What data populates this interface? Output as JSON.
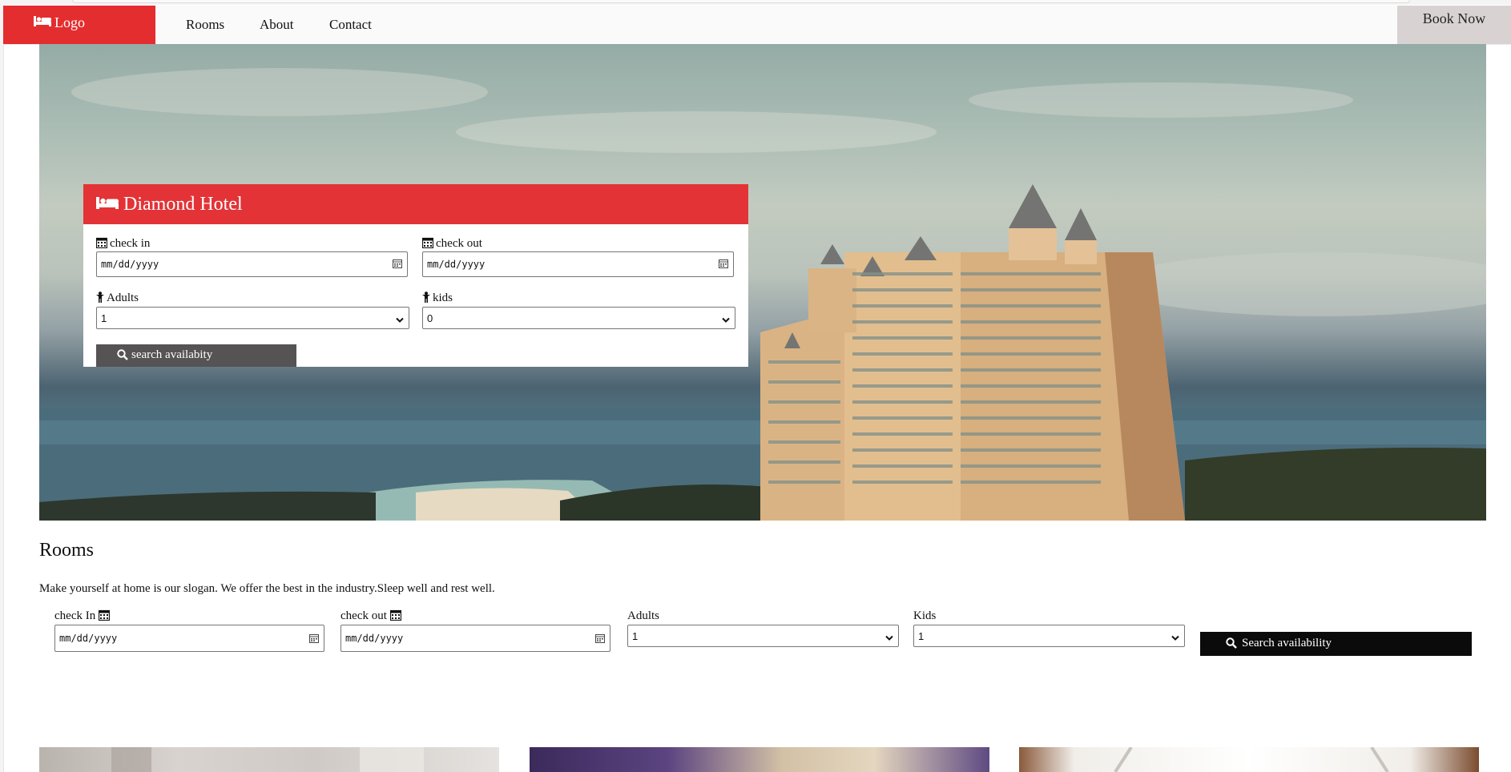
{
  "nav": {
    "logo": "Logo",
    "links": [
      "Rooms",
      "About",
      "Contact"
    ],
    "book_now": "Book Now"
  },
  "booking": {
    "title": "Diamond Hotel",
    "check_in_label": "check in",
    "check_out_label": "check out",
    "date_placeholder": "mm/dd/yyyy",
    "adults_label": "Adults",
    "adults_value": "1",
    "kids_label": "kids",
    "kids_value": "0",
    "search_label": "search availabity"
  },
  "rooms": {
    "title": "Rooms",
    "slogan": "Make yourself at home is our slogan. We offer the best in the industry.Sleep well and rest well.",
    "check_in_label": "check In",
    "check_out_label": "check out",
    "date_placeholder": "mm/dd/yyyy",
    "adults_label": "Adults",
    "adults_value": "1",
    "kids_label": "Kids",
    "kids_value": "1",
    "search_label": "Search availability"
  },
  "colors": {
    "brand_red": "#e32d2f",
    "book_now_bg": "#d9d2d2",
    "search_btn_dark": "#555354",
    "search_btn_black": "#0b0b0b"
  },
  "icons": [
    "bed-icon",
    "calendar-icon",
    "person-icon",
    "search-icon",
    "chevron-down-icon"
  ]
}
